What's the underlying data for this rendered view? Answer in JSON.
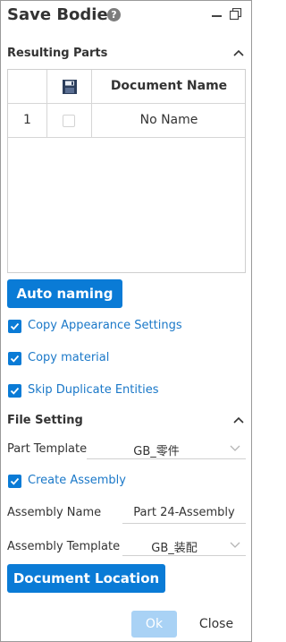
{
  "window": {
    "title": "Save Bodies",
    "help_icon": "help-icon",
    "minimize_icon": "minimize-icon",
    "restore_icon": "restore-icon"
  },
  "resulting_parts": {
    "header": "Resulting Parts",
    "table": {
      "columns": [
        "",
        "save-icon",
        "Document Name"
      ],
      "header_name": "Document Name",
      "rows": [
        {
          "index": "1",
          "checked": false,
          "name": "No Name"
        }
      ]
    },
    "auto_naming_label": "Auto naming",
    "options": [
      {
        "label": "Copy Appearance Settings",
        "checked": true
      },
      {
        "label": "Copy material",
        "checked": true
      },
      {
        "label": "Skip Duplicate Entities",
        "checked": true
      }
    ]
  },
  "file_setting": {
    "header": "File Setting",
    "part_template_label": "Part Template",
    "part_template_value": "GB_零件",
    "create_assembly_label": "Create Assembly",
    "create_assembly_checked": true,
    "assembly_name_label": "Assembly Name",
    "assembly_name_value": "Part 24-Assembly",
    "assembly_template_label": "Assembly Template",
    "assembly_template_value": "GB_装配",
    "document_location_label": "Document Location"
  },
  "footer": {
    "ok_label": "Ok",
    "close_label": "Close"
  },
  "colors": {
    "accent": "#0a7bd6",
    "link_text": "#1a78c8",
    "ok_disabled": "#a9d2f5"
  }
}
